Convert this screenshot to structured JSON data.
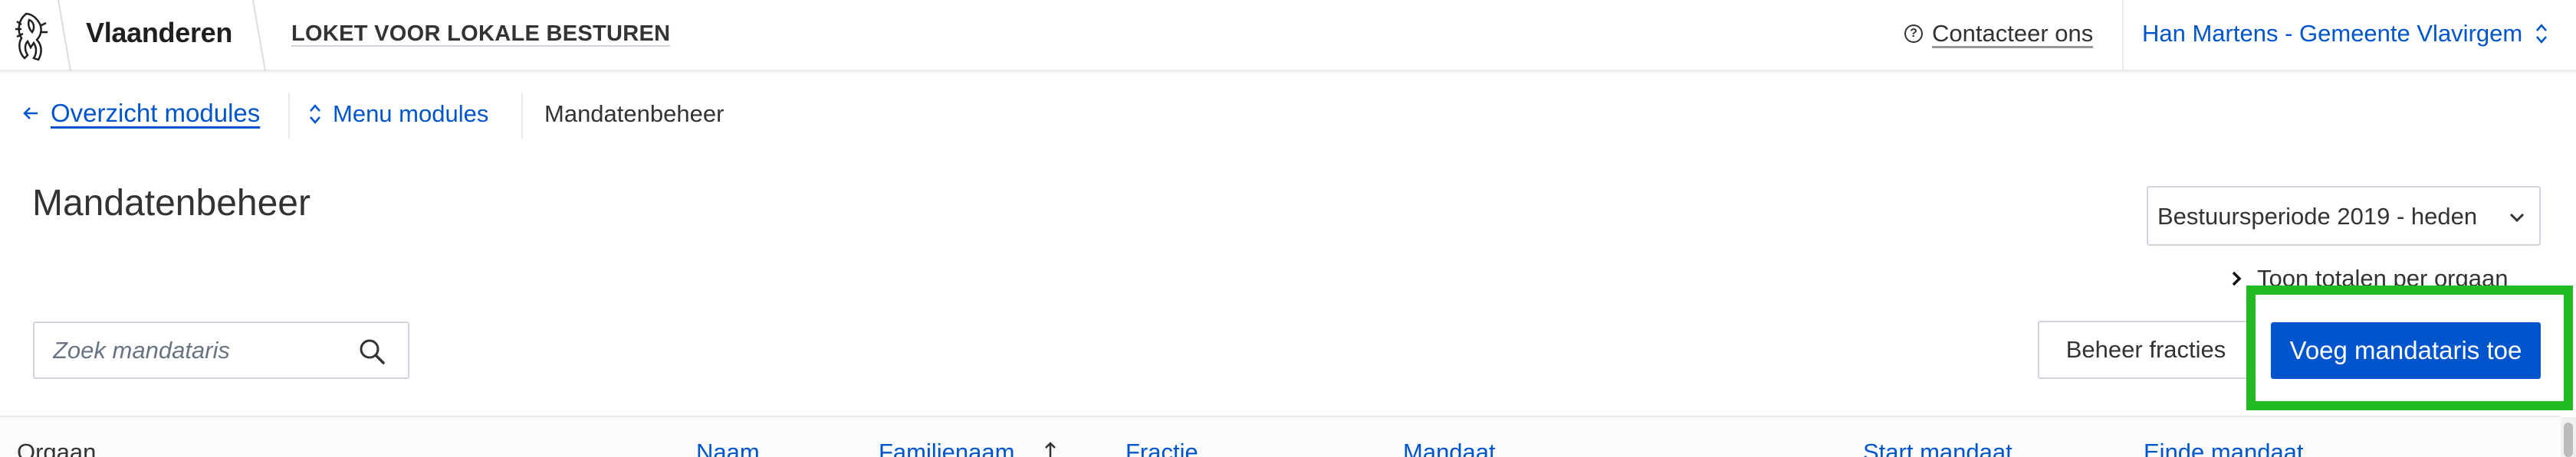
{
  "header": {
    "brand": "Vlaanderen",
    "app_title": "LOKET VOOR LOKALE BESTUREN",
    "contact_label": "Contacteer ons",
    "user_label": "Han Martens - Gemeente Vlavirgem"
  },
  "breadcrumb": {
    "back_label": "Overzicht modules",
    "menu_label": "Menu modules",
    "current_label": "Mandatenbeheer"
  },
  "main": {
    "title": "Mandatenbeheer",
    "period_select_value": "Bestuursperiode 2019 - heden",
    "totals_toggle_label": "Toon totalen per orgaan",
    "search_placeholder": "Zoek mandataris",
    "manage_factions_label": "Beheer fracties",
    "add_mandatary_label": "Voeg mandataris toe"
  },
  "table": {
    "columns": [
      "Orgaan",
      "Naam",
      "Familienaam",
      "Fractie",
      "Mandaat",
      "Start mandaat",
      "Einde mandaat"
    ]
  },
  "colors": {
    "accent_blue": "#0055cc",
    "highlight_green": "#22bb22",
    "border_gray": "#cfd5dd"
  },
  "icons": [
    "flemish-lion-logo",
    "help-circle-icon",
    "updown-chevron-icon",
    "arrow-left-icon",
    "chevron-down-icon",
    "chevron-right-icon",
    "search-icon",
    "sort-up-icon"
  ]
}
